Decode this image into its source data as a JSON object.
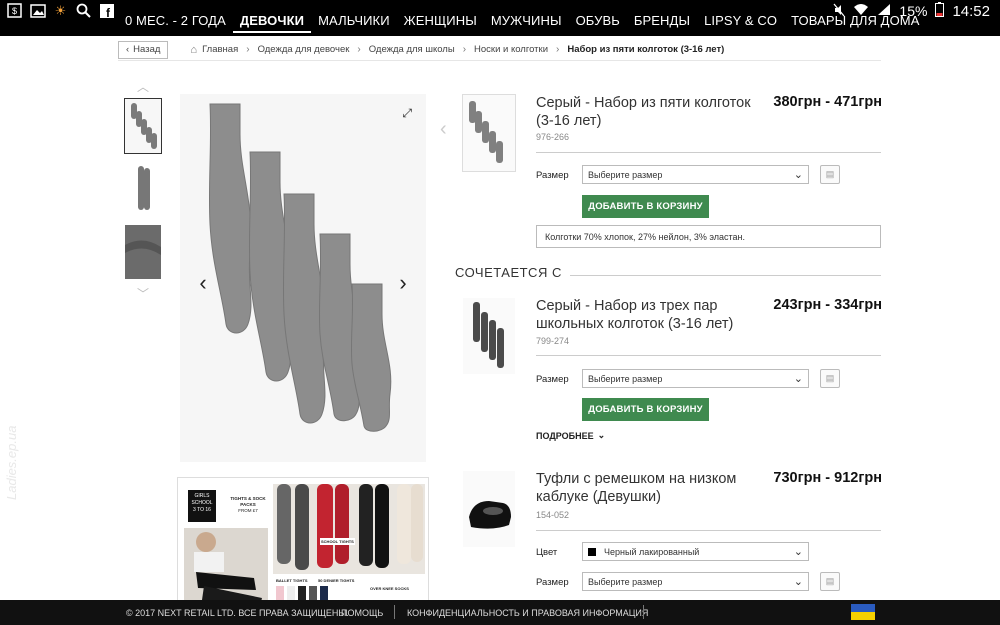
{
  "statusbar": {
    "battery": "15%",
    "time": "14:52",
    "icons": [
      "s-icon",
      "image-icon",
      "weather-icon",
      "search-icon",
      "facebook-icon",
      "mute-icon",
      "wifi-icon",
      "signal-icon",
      "battery-icon"
    ]
  },
  "nav": {
    "items": [
      "0 МЕС. - 2 ГОДА",
      "ДЕВОЧКИ",
      "МАЛЬЧИКИ",
      "ЖЕНЩИНЫ",
      "МУЖЧИНЫ",
      "ОБУВЬ",
      "БРЕНДЫ",
      "LIPSY & CO",
      "ТОВАРЫ ДЛЯ ДОМА"
    ],
    "active_index": 1
  },
  "breadcrumb": {
    "back_label": "Назад",
    "items": [
      "Главная",
      "Одежда для девочек",
      "Одежда для школы",
      "Носки и колготки",
      "Набор из пяти колготок (3-16 лет)"
    ]
  },
  "main_product": {
    "title": "Серый - Набор из пяти колготок (3-16 лет)",
    "price": "380грн - 471грн",
    "code": "976-266",
    "size_label": "Размер",
    "size_placeholder": "Выберите размер",
    "add_to_cart": "ДОБАВИТЬ В КОРЗИНУ",
    "composition": "Колготки 70% хлопок, 27% нейлон, 3% эластан."
  },
  "related_section_title": "СОЧЕТАЕТСЯ С",
  "related": [
    {
      "title": "Серый - Набор из трех пар школьных колготок (3-16 лет)",
      "price": "243грн - 334грн",
      "code": "799-274",
      "size_label": "Размер",
      "size_placeholder": "Выберите размер",
      "add_to_cart": "ДОБАВИТЬ В КОРЗИНУ",
      "more": "ПОДРОБНЕЕ"
    },
    {
      "title": "Туфли с ремешком на низком каблуке (Девушки)",
      "price": "730грн - 912грн",
      "code": "154-052",
      "color_label": "Цвет",
      "color_value": "Черный лакированный",
      "size_label": "Размер",
      "size_placeholder": "Выберите размер"
    }
  ],
  "promo": {
    "badge_line1": "GIRLS",
    "badge_line2": "SCHOOL",
    "badge_line3": "3 TO 16",
    "tights_title": "TIGHTS & SOCK PACKS",
    "tights_sub": "FROM £7",
    "school_tights": "SCHOOL TIGHTS",
    "ballet_tights": "BALLET TIGHTS",
    "denier_tights": "50 DENIER TIGHTS",
    "overknee": "OVER KNEE SOCKS"
  },
  "footer": {
    "copyright": "© 2017 NEXT RETAIL LTD. ВСЕ ПРАВА ЗАЩИЩЕНЫ.",
    "help": "ПОМОЩЬ",
    "privacy": "КОНФИДЕНЦИАЛЬНОСТЬ И ПРАВОВАЯ ИНФОРМАЦИЯ"
  },
  "watermark": "Ladies.ep.ua"
}
